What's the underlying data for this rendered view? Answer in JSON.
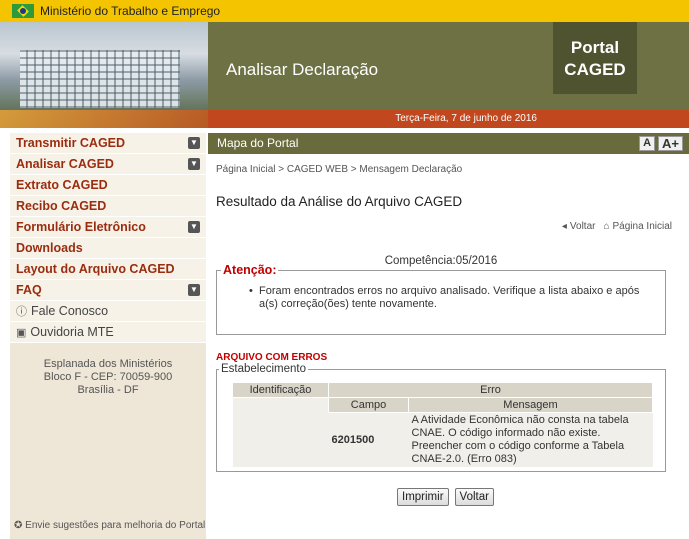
{
  "header": {
    "ministry": "Ministério do Trabalho e Emprego",
    "page_heading": "Analisar Declaração",
    "portal_line1": "Portal",
    "portal_line2": "CAGED",
    "date": "Terça-Feira, 7 de junho de 2016"
  },
  "sidebar": {
    "items": [
      {
        "label": "Transmitir CAGED",
        "expandable": true
      },
      {
        "label": "Analisar CAGED",
        "expandable": true
      },
      {
        "label": "Extrato CAGED",
        "expandable": false
      },
      {
        "label": "Recibo CAGED",
        "expandable": false
      },
      {
        "label": "Formulário Eletrônico",
        "expandable": true
      },
      {
        "label": "Downloads",
        "expandable": false
      },
      {
        "label": "Layout do Arquivo CAGED",
        "expandable": false
      },
      {
        "label": "FAQ",
        "expandable": true
      }
    ],
    "fale_conosco": "Fale Conosco",
    "ouvidoria": "Ouvidoria MTE",
    "address_line1": "Esplanada dos Ministérios",
    "address_line2": "Bloco F - CEP: 70059-900",
    "address_line3": "Brasília - DF",
    "suggestion": "Envie sugestões para melhoria do Portal"
  },
  "mapbar": {
    "label": "Mapa do Portal",
    "font_small": "A",
    "font_large": "A+"
  },
  "breadcrumb": "Página Inicial > CAGED WEB > Mensagem Declaração",
  "main": {
    "title": "Resultado da Análise do Arquivo CAGED",
    "back_label": "Voltar",
    "home_label": "Página Inicial",
    "competencia": "Competência:05/2016",
    "attention_legend": "Atenção:",
    "attention_text": "Foram encontrados erros no arquivo analisado. Verifique a lista abaixo e após a(s) correção(ões) tente novamente.",
    "arquivo_status": "ARQUIVO COM ERROS",
    "estabelecimento_legend": "Estabelecimento",
    "table": {
      "col_identificacao": "Identificação",
      "col_erro": "Erro",
      "col_campo": "Campo",
      "col_mensagem": "Mensagem",
      "rows": [
        {
          "identificacao": "",
          "campo": "6201500",
          "mensagem": "A Atividade Econômica não consta na tabela CNAE. O código informado não existe. Preencher com o código conforme a Tabela CNAE-2.0. (Erro 083)"
        }
      ]
    },
    "print_button": "Imprimir",
    "back_button": "Voltar"
  },
  "colors": {
    "topbar": "#f5c400",
    "banner": "#6d7143",
    "portal_box": "#4f5330",
    "date_strip": "#c1471e",
    "menu_text": "#9a2d10",
    "alert_red": "#c00000"
  }
}
